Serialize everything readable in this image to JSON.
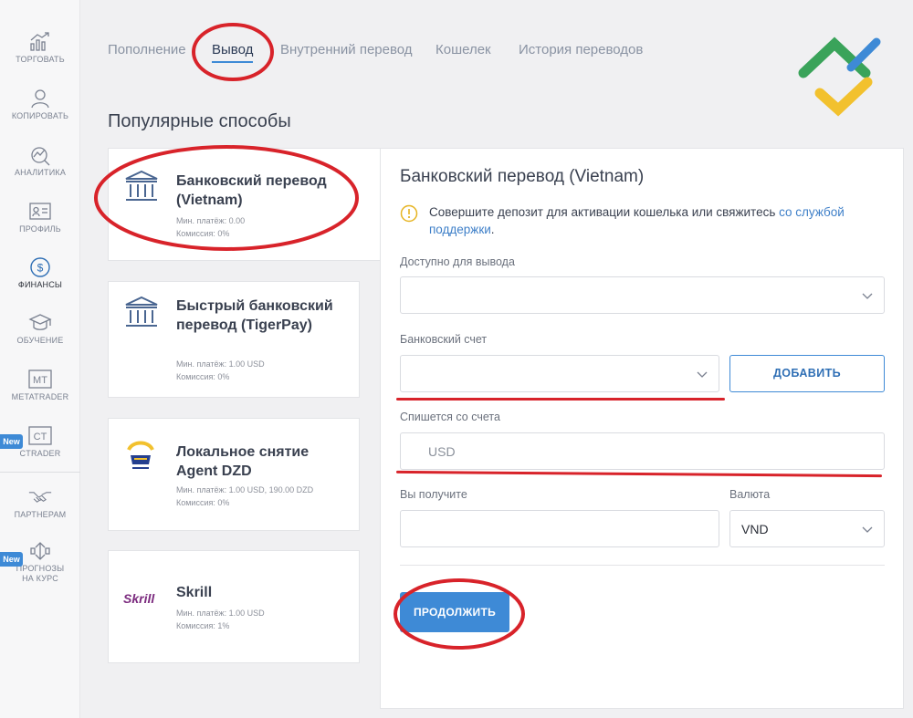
{
  "sidebar": {
    "items": [
      {
        "label": "ТОРГОВАТЬ",
        "icon": "chart-growth-icon"
      },
      {
        "label": "КОПИРОВАТЬ",
        "icon": "user-icon"
      },
      {
        "label": "АНАЛИТИКА",
        "icon": "analytics-icon"
      },
      {
        "label": "ПРОФИЛЬ",
        "icon": "id-card-icon"
      },
      {
        "label": "ФИНАНСЫ",
        "icon": "dollar-circle-icon"
      },
      {
        "label": "ОБУЧЕНИЕ",
        "icon": "graduation-cap-icon"
      },
      {
        "label": "METATRADER",
        "icon": "mt-icon",
        "icon_text": "MT"
      },
      {
        "label": "CTRADER",
        "icon": "ct-icon",
        "icon_text": "CT",
        "badge": "New"
      },
      {
        "label": "ПАРТНЕРАМ",
        "icon": "handshake-icon"
      },
      {
        "label": "ПРОГНОЗЫ НА КУРС",
        "icon": "forecast-icon",
        "badge": "New"
      }
    ],
    "active_index": 4
  },
  "tabs": [
    {
      "label": "Пополнение"
    },
    {
      "label": "Вывод",
      "active": true
    },
    {
      "label": "Внутренний перевод"
    },
    {
      "label": "Кошелек"
    },
    {
      "label": "История переводов"
    }
  ],
  "section_title": "Популярные способы",
  "methods": [
    {
      "name": "Банковский перевод (Vietnam)",
      "min": "Мин. платёж: 0.00",
      "fee": "Комиссия: 0%",
      "icon": "bank-icon",
      "selected": true
    },
    {
      "name": "Быстрый банковский перевод (TigerPay)",
      "min": "Мин. платёж: 1.00 USD",
      "fee": "Комиссия: 0%",
      "icon": "bank-icon"
    },
    {
      "name": "Локальное снятие Agent DZD",
      "min": "Мин. платёж: 1.00 USD, 190.00 DZD",
      "fee": "Комиссия: 0%",
      "icon": "agent-logo-icon"
    },
    {
      "name": "Skrill",
      "min": "Мин. платёж: 1.00 USD",
      "fee": "Комиссия: 1%",
      "icon": "skrill-logo-icon",
      "logo_text": "Skrill"
    }
  ],
  "panel": {
    "title": "Банковский перевод (Vietnam)",
    "notice_text": "Совершите депозит для активации кошелька или свяжитесь ",
    "notice_link": "со службой поддержки",
    "notice_end": ".",
    "available_label": "Доступно для вывода",
    "available_value": "",
    "bank_account_label": "Банковский счет",
    "bank_account_value": "",
    "add_button": "ДОБАВИТЬ",
    "debit_label": "Спишется со счета",
    "debit_value": "USD",
    "receive_label": "Вы получите",
    "receive_value": "",
    "currency_label": "Валюта",
    "currency_value": "VND",
    "continue_button": "ПРОДОЛЖИТЬ"
  },
  "colors": {
    "accent": "#3e8ad6",
    "annotation": "#d8232a",
    "logo_green": "#3aa35a",
    "logo_yellow": "#f2c12e",
    "logo_blue": "#3e8ad6",
    "skrill": "#7b2a7e"
  }
}
